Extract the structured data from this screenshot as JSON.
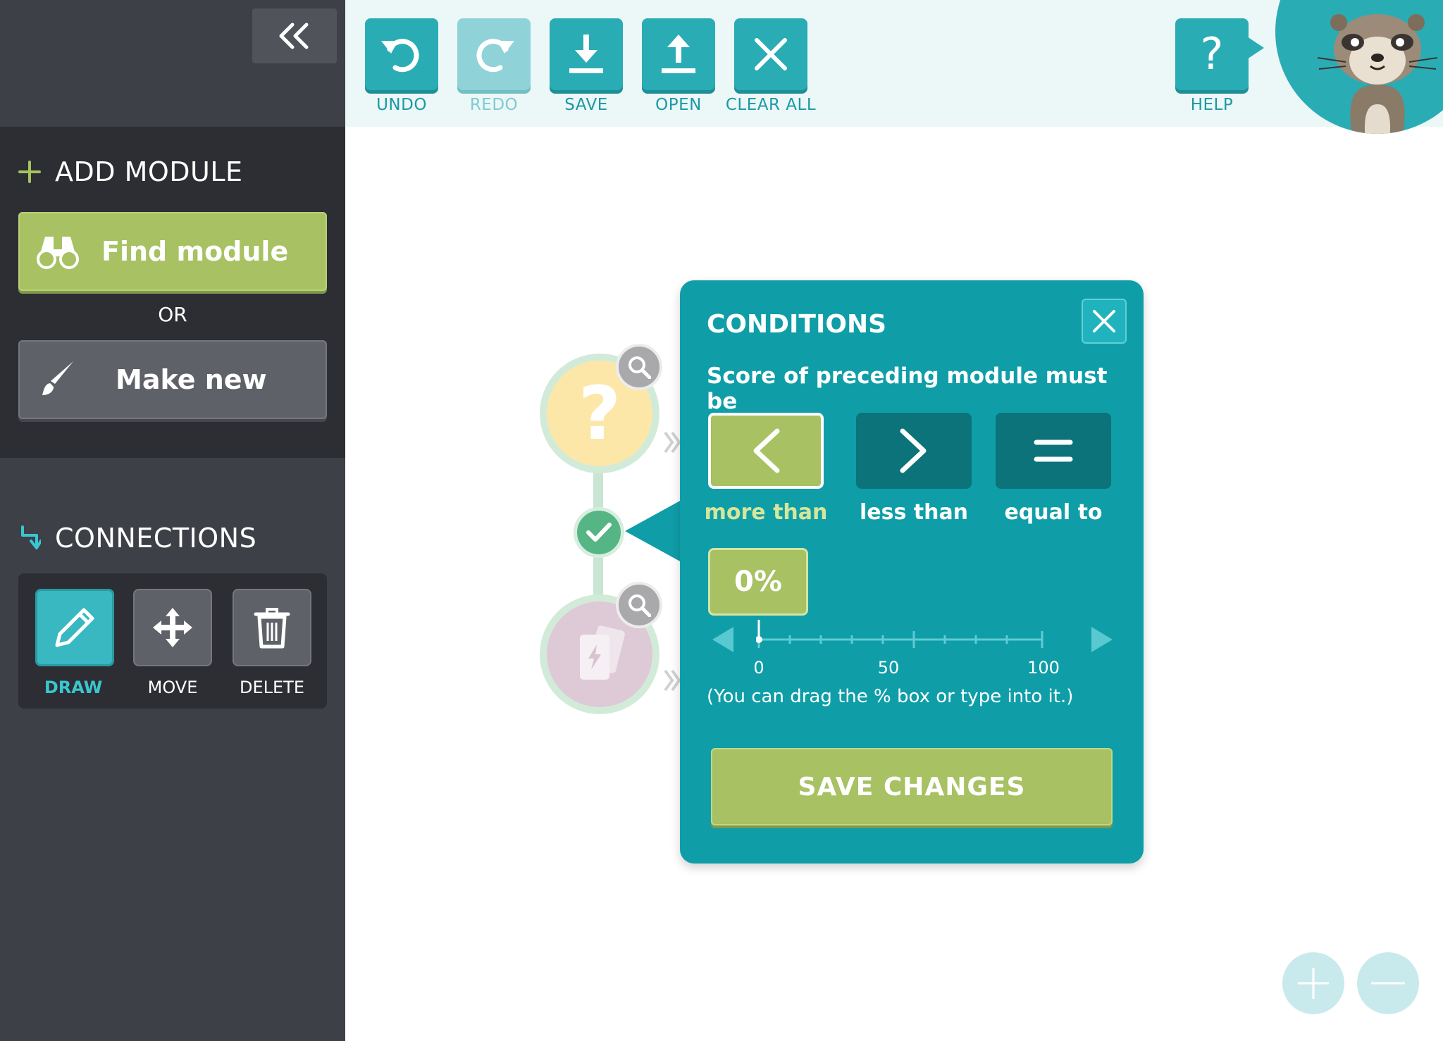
{
  "sidebar": {
    "collapse_icon": "double-chevron-left-icon",
    "add_module": {
      "title": "ADD MODULE",
      "find_label": "Find module",
      "or_label": "OR",
      "make_label": "Make new"
    },
    "connections": {
      "title": "CONNECTIONS",
      "tools": [
        {
          "label": "DRAW",
          "icon": "pencil-icon",
          "active": true
        },
        {
          "label": "MOVE",
          "icon": "move-arrows-icon",
          "active": false
        },
        {
          "label": "DELETE",
          "icon": "trash-icon",
          "active": false
        }
      ]
    }
  },
  "toolbar": {
    "undo": "UNDO",
    "redo": "REDO",
    "save": "SAVE",
    "open": "OPEN",
    "clear_all": "CLEAR ALL",
    "help": "HELP"
  },
  "nodes": {
    "top_symbol": "?"
  },
  "dialog": {
    "title": "CONDITIONS",
    "subtitle": "Score of preceding module must be",
    "options": [
      {
        "label": "more than",
        "symbol": "<",
        "selected": true
      },
      {
        "label": "less than",
        "symbol": ">",
        "selected": false
      },
      {
        "label": "equal to",
        "symbol": "=",
        "selected": false
      }
    ],
    "percent": "0%",
    "slider": {
      "min_label": "0",
      "mid_label": "50",
      "max_label": "100",
      "value": 0
    },
    "hint": "(You can drag the % box or type into it.)",
    "save_label": "SAVE CHANGES"
  },
  "colors": {
    "teal": "#0f9ea8",
    "green": "#a7c163",
    "sidebar_dark": "#2c2e33",
    "sidebar": "#3e4047"
  }
}
